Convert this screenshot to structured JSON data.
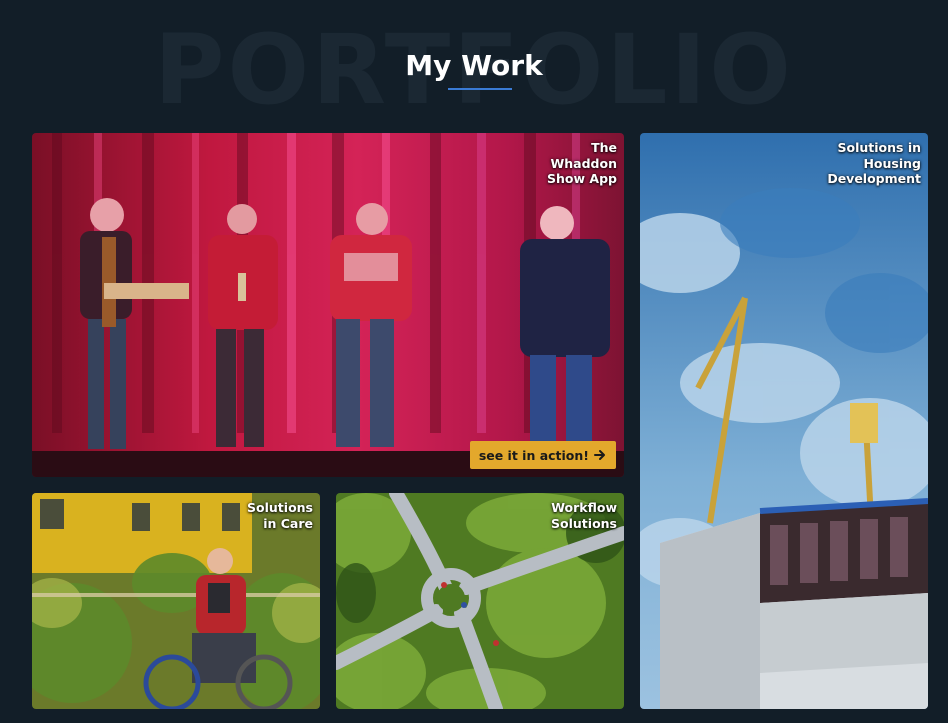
{
  "section": {
    "background_word": "PORTFOLIO",
    "title": "My Work",
    "underline_color": "#3a7bd5"
  },
  "projects": [
    {
      "label": "The Whaddon Show App",
      "image": "theatre-stage-performers-illustration",
      "cta_label": "see it in action!",
      "cta_icon": "arrow-right-icon",
      "cta_color": "#e3a82c"
    },
    {
      "label": "Solutions in Housing Development",
      "image": "construction-cranes-building-illustration"
    },
    {
      "label": "Solutions in Care",
      "image": "wheelchair-user-garden-illustration"
    },
    {
      "label": "Workflow Solutions",
      "image": "aerial-roundabout-illustration"
    }
  ]
}
